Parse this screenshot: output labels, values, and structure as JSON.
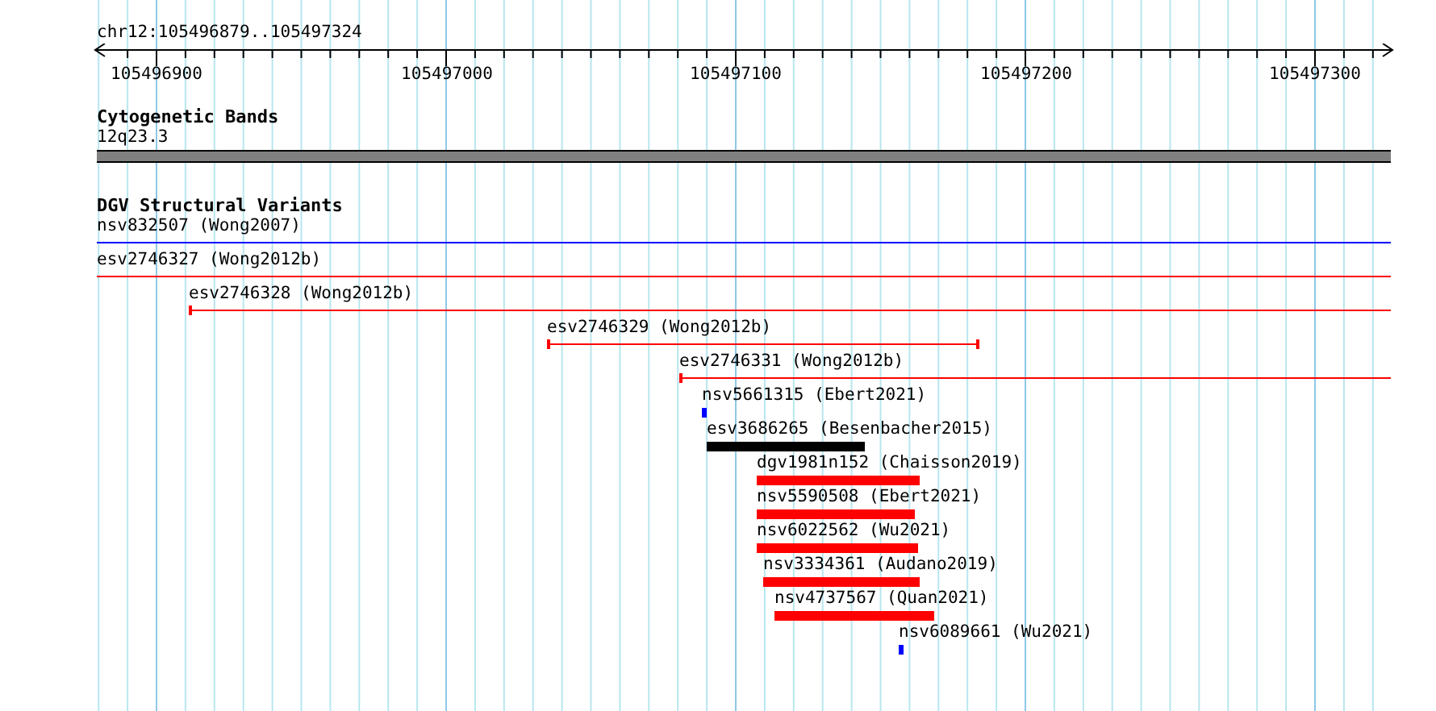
{
  "location": "chr12:105496879..105497324",
  "ruler": {
    "ticks": [
      "105496900",
      "105497000",
      "105497100",
      "105497200",
      "105497300"
    ]
  },
  "tracks": [
    {
      "title": "Cytogenetic Bands",
      "kind": "bands",
      "features": [
        {
          "label": "12q23.3"
        }
      ]
    },
    {
      "title": "DGV Structural Variants",
      "kind": "variants",
      "features": [
        {
          "label": "nsv832507 (Wong2007)",
          "kind": "line",
          "color": "#0000ff"
        },
        {
          "label": "esv2746327 (Wong2012b)",
          "kind": "line",
          "color": "#ff0000"
        },
        {
          "label": "esv2746328 (Wong2012b)",
          "kind": "line",
          "color": "#ff0000"
        },
        {
          "label": "esv2746329 (Wong2012b)",
          "kind": "line",
          "color": "#ff0000"
        },
        {
          "label": "esv2746331 (Wong2012b)",
          "kind": "line",
          "color": "#ff0000"
        },
        {
          "label": "nsv5661315 (Ebert2021)",
          "kind": "block",
          "color": "#0000ff"
        },
        {
          "label": "esv3686265 (Besenbacher2015)",
          "kind": "block",
          "color": "#000000"
        },
        {
          "label": "dgv1981n152 (Chaisson2019)",
          "kind": "block",
          "color": "#ff0000"
        },
        {
          "label": "nsv5590508 (Ebert2021)",
          "kind": "block",
          "color": "#ff0000"
        },
        {
          "label": "nsv6022562 (Wu2021)",
          "kind": "block",
          "color": "#ff0000"
        },
        {
          "label": "nsv3334361 (Audano2019)",
          "kind": "block",
          "color": "#ff0000"
        },
        {
          "label": "nsv4737567 (Quan2021)",
          "kind": "block",
          "color": "#ff0000"
        },
        {
          "label": "nsv6089661 (Wu2021)",
          "kind": "block",
          "color": "#0000ff"
        }
      ]
    }
  ]
}
